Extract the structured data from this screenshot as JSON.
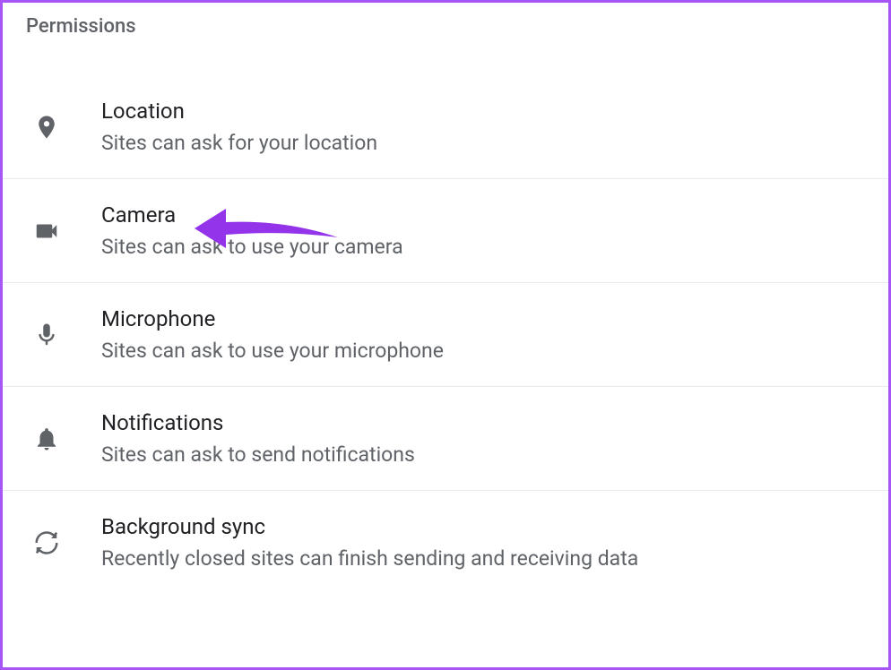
{
  "section": {
    "title": "Permissions"
  },
  "items": [
    {
      "icon": "location",
      "title": "Location",
      "subtitle": "Sites can ask for your location"
    },
    {
      "icon": "camera",
      "title": "Camera",
      "subtitle": "Sites can ask to use your camera"
    },
    {
      "icon": "microphone",
      "title": "Microphone",
      "subtitle": "Sites can ask to use your microphone"
    },
    {
      "icon": "notifications",
      "title": "Notifications",
      "subtitle": "Sites can ask to send notifications"
    },
    {
      "icon": "sync",
      "title": "Background sync",
      "subtitle": "Recently closed sites can finish sending and receiving data"
    }
  ],
  "annotation": {
    "arrow_color": "#9333ea",
    "target": "Camera"
  }
}
